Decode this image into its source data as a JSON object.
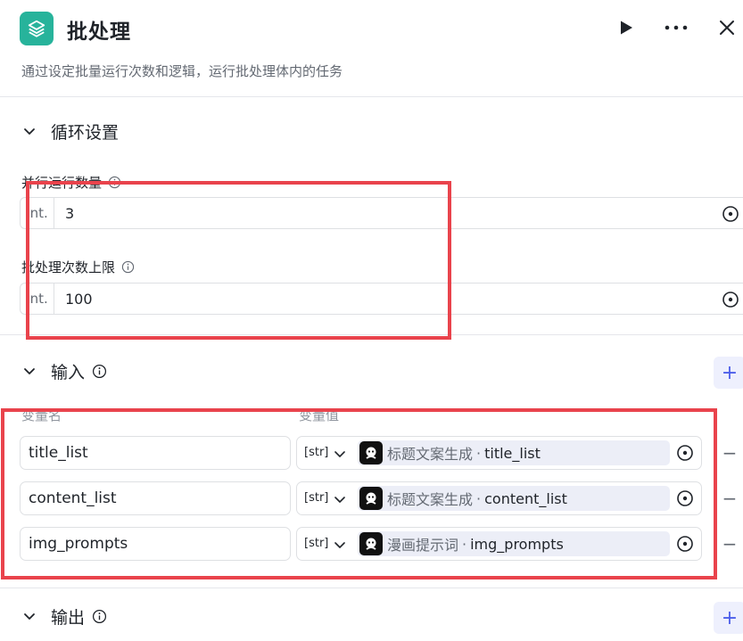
{
  "header": {
    "title": "批处理",
    "description": "通过设定批量运行次数和逻辑，运行批处理体内的任务",
    "icons": {
      "app": "layers-icon",
      "run": "play-icon",
      "more": "more-dots-icon",
      "close": "close-icon"
    }
  },
  "loop_section": {
    "title": "循环设置",
    "fields": [
      {
        "label": "并行运行数量",
        "type_tag": "Int.",
        "value": "3"
      },
      {
        "label": "批处理次数上限",
        "type_tag": "Int.",
        "value": "100"
      }
    ]
  },
  "input_section": {
    "title": "输入",
    "col_name": "变量名",
    "col_value": "变量值",
    "rows": [
      {
        "name": "title_list",
        "type_tag": "[str]",
        "node": "标题文案生成",
        "sep": "·",
        "var": "title_list"
      },
      {
        "name": "content_list",
        "type_tag": "[str]",
        "node": "标题文案生成",
        "sep": "·",
        "var": "content_list"
      },
      {
        "name": "img_prompts",
        "type_tag": "[str]",
        "node": "漫画提示词",
        "sep": "·",
        "var": "img_prompts"
      }
    ],
    "add_label": "+",
    "remove_label": "−"
  },
  "output_section": {
    "title": "输出",
    "add_label": "+"
  },
  "colors": {
    "accent": "#4c5eea",
    "app_icon_bg": "#27b39b",
    "annotation": "#e9434c",
    "border": "#dee0e3"
  }
}
